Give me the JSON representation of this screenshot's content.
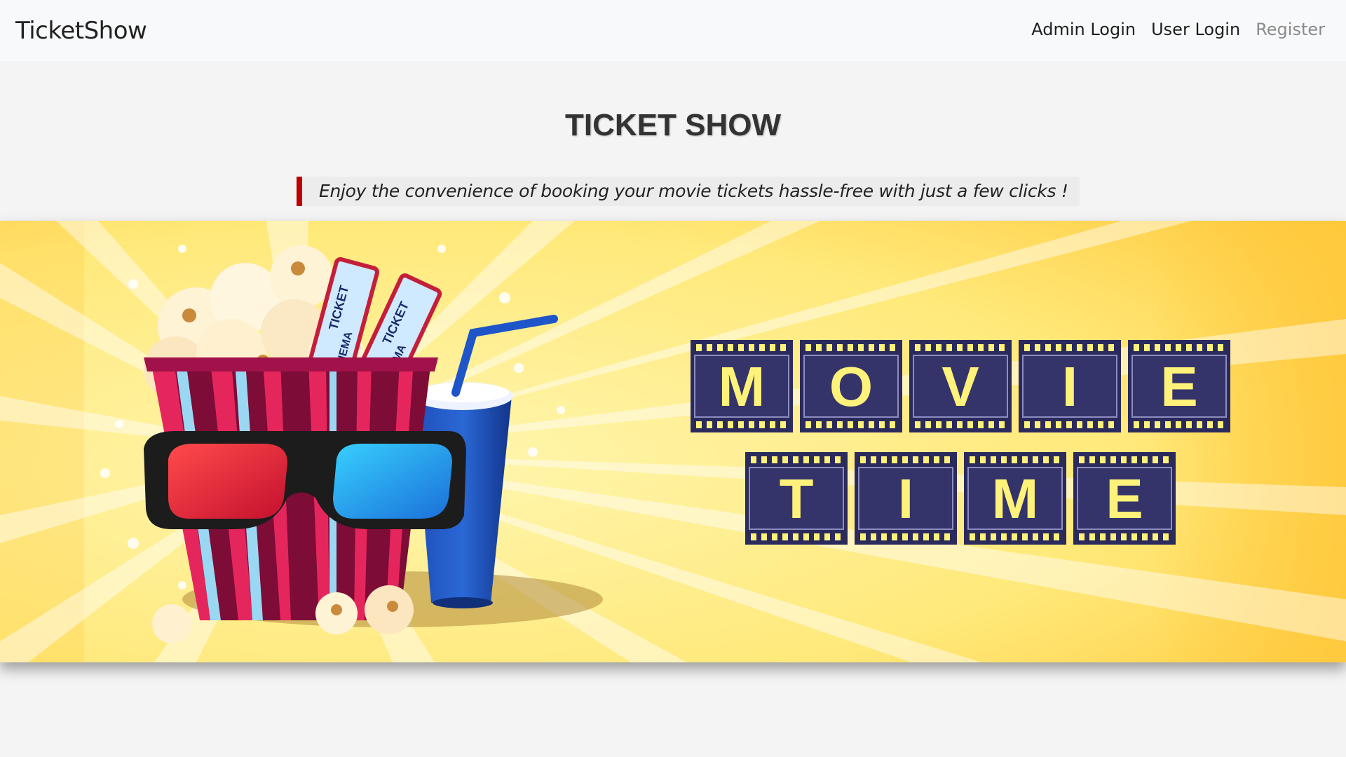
{
  "navbar": {
    "brand": "TicketShow",
    "links": [
      {
        "label": "Admin Login"
      },
      {
        "label": "User Login"
      },
      {
        "label": "Register"
      }
    ]
  },
  "hero": {
    "title": "TICKET SHOW",
    "tagline": "Enjoy the convenience of booking your movie tickets hassle-free with just a few clicks !"
  },
  "banner": {
    "ticket_labels": [
      "TICKET",
      "CINEMA"
    ],
    "headline_row1": [
      "M",
      "O",
      "V",
      "I",
      "E"
    ],
    "headline_row2": [
      "T",
      "I",
      "M",
      "E"
    ],
    "colors": {
      "background": "#ffe97a",
      "film_frame": "#2b2a5c",
      "letter": "#fff27a",
      "accent_red": "#c00000"
    }
  }
}
